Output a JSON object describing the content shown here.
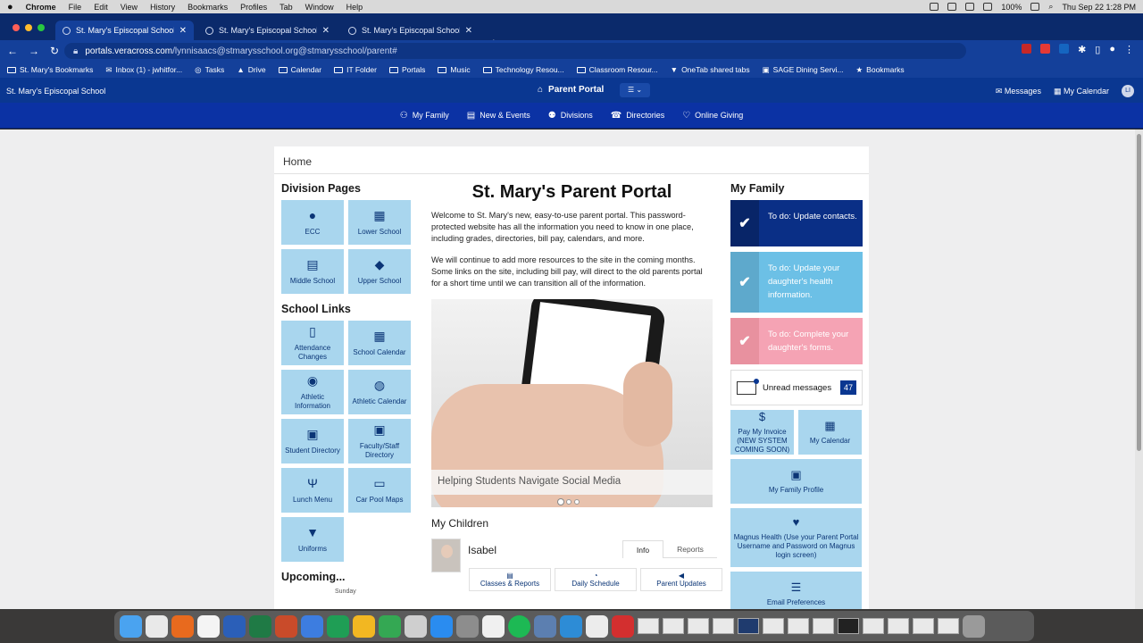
{
  "menubar": {
    "app": "Chrome",
    "items": [
      "File",
      "Edit",
      "View",
      "History",
      "Bookmarks",
      "Profiles",
      "Tab",
      "Window",
      "Help"
    ],
    "battery": "100%",
    "datetime": "Thu Sep 22  1:28 PM"
  },
  "browser": {
    "tabs": [
      {
        "title": "St. Mary's Episcopal School - ",
        "close": "✕"
      },
      {
        "title": "St. Mary's Episcopal School - ",
        "close": "✕"
      },
      {
        "title": "St. Mary's Episcopal School Pa",
        "close": "✕"
      }
    ],
    "new_tab": "+",
    "url_host": "portals.veracross.com",
    "url_path": "/lynnisaacs@stmarysschool.org@stmarysschool/parent#",
    "bookmarks": [
      "St. Mary's Bookmarks",
      "Inbox (1) - jwhitfor...",
      "Tasks",
      "Drive",
      "Calendar",
      "IT Folder",
      "Portals",
      "Music",
      "Technology Resou...",
      "Classroom Resour...",
      "OneTab shared tabs",
      "SAGE Dining Servi...",
      "Bookmarks"
    ]
  },
  "site": {
    "school_name": "St. Mary's Episcopal School",
    "portal_title": "Parent Portal",
    "messages_label": "Messages",
    "calendar_label": "My Calendar",
    "user_initials": "LI",
    "nav": [
      {
        "label": "My Family",
        "icon": "family-icon"
      },
      {
        "label": "New & Events",
        "icon": "news-icon"
      },
      {
        "label": "Divisions",
        "icon": "divisions-icon"
      },
      {
        "label": "Directories",
        "icon": "directories-icon"
      },
      {
        "label": "Online Giving",
        "icon": "giving-icon"
      }
    ]
  },
  "page": {
    "breadcrumb": "Home",
    "division_title": "Division Pages",
    "divisions": [
      {
        "label": "ECC",
        "icon": "apple-icon",
        "glyph": "●"
      },
      {
        "label": "Lower School",
        "icon": "school-icon",
        "glyph": "▦"
      },
      {
        "label": "Middle School",
        "icon": "book-icon",
        "glyph": "▤"
      },
      {
        "label": "Upper School",
        "icon": "graduation-cap-icon",
        "glyph": "◆"
      }
    ],
    "links_title": "School Links",
    "links": [
      {
        "label": "Attendance Changes",
        "icon": "clipboard-icon",
        "glyph": "▯"
      },
      {
        "label": "School Calendar",
        "icon": "calendar-icon",
        "glyph": "▦"
      },
      {
        "label": "Athletic Information",
        "icon": "soccer-ball-icon",
        "glyph": "◉"
      },
      {
        "label": "Athletic Calendar",
        "icon": "volleyball-icon",
        "glyph": "◍"
      },
      {
        "label": "Student Directory",
        "icon": "address-book-icon",
        "glyph": "▣"
      },
      {
        "label": "Faculty/Staff Directory",
        "icon": "contact-book-icon",
        "glyph": "▣"
      },
      {
        "label": "Lunch Menu",
        "icon": "utensils-icon",
        "glyph": "Ψ"
      },
      {
        "label": "Car Pool Maps",
        "icon": "car-icon",
        "glyph": "▭"
      },
      {
        "label": "Uniforms",
        "icon": "shirt-icon",
        "glyph": "▼"
      }
    ],
    "upcoming_title": "Upcoming...",
    "upcoming_day": "Sunday",
    "main_title": "St. Mary's Parent Portal",
    "intro_1": "Welcome to St. Mary's new, easy-to-use parent portal. This password-protected website has all the information you need to know in one place, including grades, directories, bill pay, calendars, and more.",
    "intro_2": "We will continue to add more resources to the site in the coming months. Some links on the site, including bill pay, will direct to the old parents portal for a short time until we can transition all of the information.",
    "hero_caption": "Helping Students Navigate Social Media",
    "children_title": "My Children",
    "child_name": "Isabel",
    "child_tabs": [
      "Info",
      "Reports"
    ],
    "child_buttons": [
      "Classes & Reports",
      "Daily Schedule",
      "Parent Updates"
    ],
    "family_title": "My Family",
    "todos": [
      {
        "text": "To do: Update contacts.",
        "color": "#0a2f86",
        "check_bg": "#082568"
      },
      {
        "text": "To do: Update your daughter's health information.",
        "color": "#6cc0e6",
        "check_bg": "#5ea9cc"
      },
      {
        "text": "To do: Complete your daughter's forms.",
        "color": "#f5a3b4",
        "check_bg": "#e8919f"
      }
    ],
    "unread_label": "Unread messages",
    "unread_count": "47",
    "family_tiles": [
      {
        "label": "Pay My Invoice (NEW SYSTEM COMING SOON)",
        "icon": "dollar-icon",
        "glyph": "$"
      },
      {
        "label": "My Calendar",
        "icon": "calendar-icon",
        "glyph": "▦"
      },
      {
        "label": "My Family Profile",
        "icon": "id-card-icon",
        "glyph": "▣"
      },
      {
        "label": "Magnus Health (Use your Parent Portal Username and Password on Magnus login screen)",
        "icon": "heart-pulse-icon",
        "glyph": "♥"
      },
      {
        "label": "Email Preferences",
        "icon": "list-icon",
        "glyph": "☰"
      }
    ]
  },
  "colors": {
    "header_blue": "#0a3791",
    "nav_blue": "#0b32a4",
    "tile_blue": "#a9d6ee",
    "tile_text": "#0b3576"
  }
}
